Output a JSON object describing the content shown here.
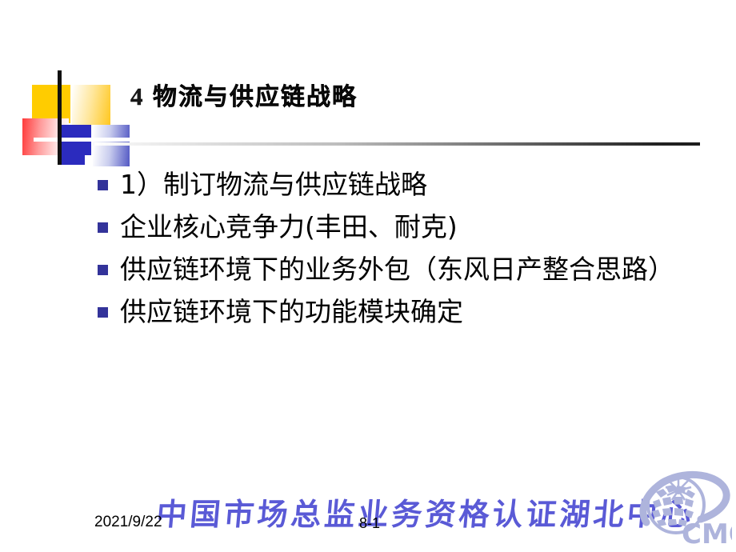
{
  "slide": {
    "title": {
      "number": "4",
      "text": "物流与供应链战略",
      "full": "4 物流与供应链战略"
    },
    "bullets": [
      {
        "text": "1）制订物流与供应链战略"
      },
      {
        "text": "企业核心竞争力(丰田、耐克)"
      },
      {
        "text": "供应链环境下的业务外包（东风日产整合思路）"
      },
      {
        "text": "供应链环境下的功能模块确定"
      }
    ],
    "footer": {
      "date": "2021/9/22",
      "page_number": "8-1",
      "watermark": "中国市场总监业务资格认证湖北中心"
    },
    "logo": {
      "name": "cmo-logo",
      "text": "CMO"
    },
    "ornament": {
      "name": "decorative-blocks",
      "colors": {
        "yellow": "#FFCC00",
        "red": "#FF3A3A",
        "blue": "#2B2BBE",
        "bar": "#101010"
      }
    },
    "colors": {
      "bullet_marker": "#33339A",
      "watermark": "#5A5AD6",
      "logo": "#AEB4DC",
      "text": "#000000",
      "background": "#FFFFFF"
    }
  }
}
